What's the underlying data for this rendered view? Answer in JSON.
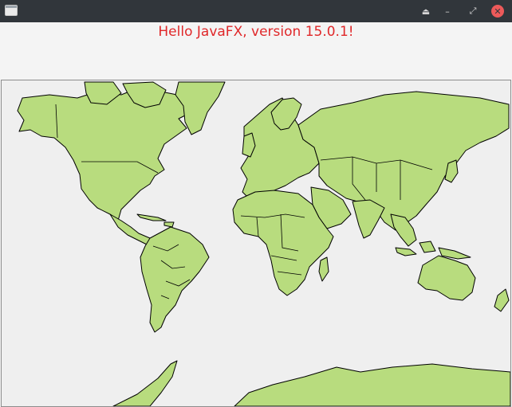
{
  "window": {
    "icons": {
      "app": "window-icon",
      "eject": "eject-icon",
      "minimize": "minimize-icon",
      "maximize": "maximize-icon",
      "close": "close-icon"
    },
    "glyphs": {
      "eject": "⏏",
      "minimize": "–",
      "maximize": "⤢",
      "close": "✕"
    }
  },
  "label": {
    "text": "Hello JavaFX, version 15.0.1!",
    "color": "#e0282a"
  },
  "map": {
    "land_color": "#b8dc7e",
    "background_color": "#efefef",
    "border_color": "#000000"
  }
}
